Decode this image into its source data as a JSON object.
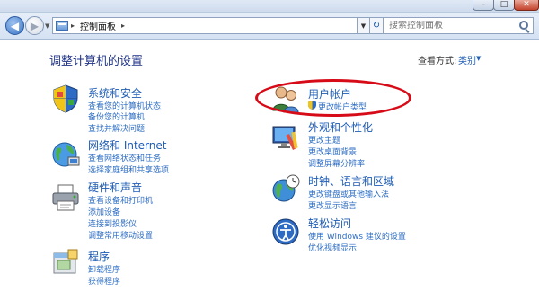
{
  "address": {
    "crumb": "控制面板",
    "search_placeholder": "搜索控制面板"
  },
  "window_controls": {
    "minimize": "–",
    "maximize": "□",
    "close": "✕"
  },
  "page": {
    "title": "调整计算机的设置",
    "view_by_label": "查看方式:",
    "view_by_value": "类别"
  },
  "categories": [
    {
      "title": "系统和安全",
      "icon": "shield-icon",
      "links": [
        "查看您的计算机状态",
        "备份您的计算机",
        "查找并解决问题"
      ]
    },
    {
      "title": "网络和 Internet",
      "icon": "network-globe-icon",
      "links": [
        "查看网络状态和任务",
        "选择家庭组和共享选项"
      ]
    },
    {
      "title": "硬件和声音",
      "icon": "printer-icon",
      "links": [
        "查看设备和打印机",
        "添加设备",
        "连接到投影仪",
        "调整常用移动设置"
      ]
    },
    {
      "title": "程序",
      "icon": "programs-icon",
      "links": [
        "卸载程序",
        "获得程序"
      ]
    },
    {
      "title": "用户帐户",
      "icon": "users-icon",
      "links": [
        "更改帐户类型"
      ]
    },
    {
      "title": "外观和个性化",
      "icon": "appearance-icon",
      "links": [
        "更改主题",
        "更改桌面背景",
        "调整屏幕分辨率"
      ]
    },
    {
      "title": "时钟、语言和区域",
      "icon": "clock-globe-icon",
      "links": [
        "更改键盘或其他输入法",
        "更改显示语言"
      ]
    },
    {
      "title": "轻松访问",
      "icon": "ease-of-access-icon",
      "links": [
        "使用 Windows 建议的设置",
        "优化视频显示"
      ]
    }
  ],
  "colors": {
    "link": "#2e6ec4",
    "category_title": "#1e5cb5",
    "page_title": "#1e3287",
    "highlight": "#d60b17"
  }
}
